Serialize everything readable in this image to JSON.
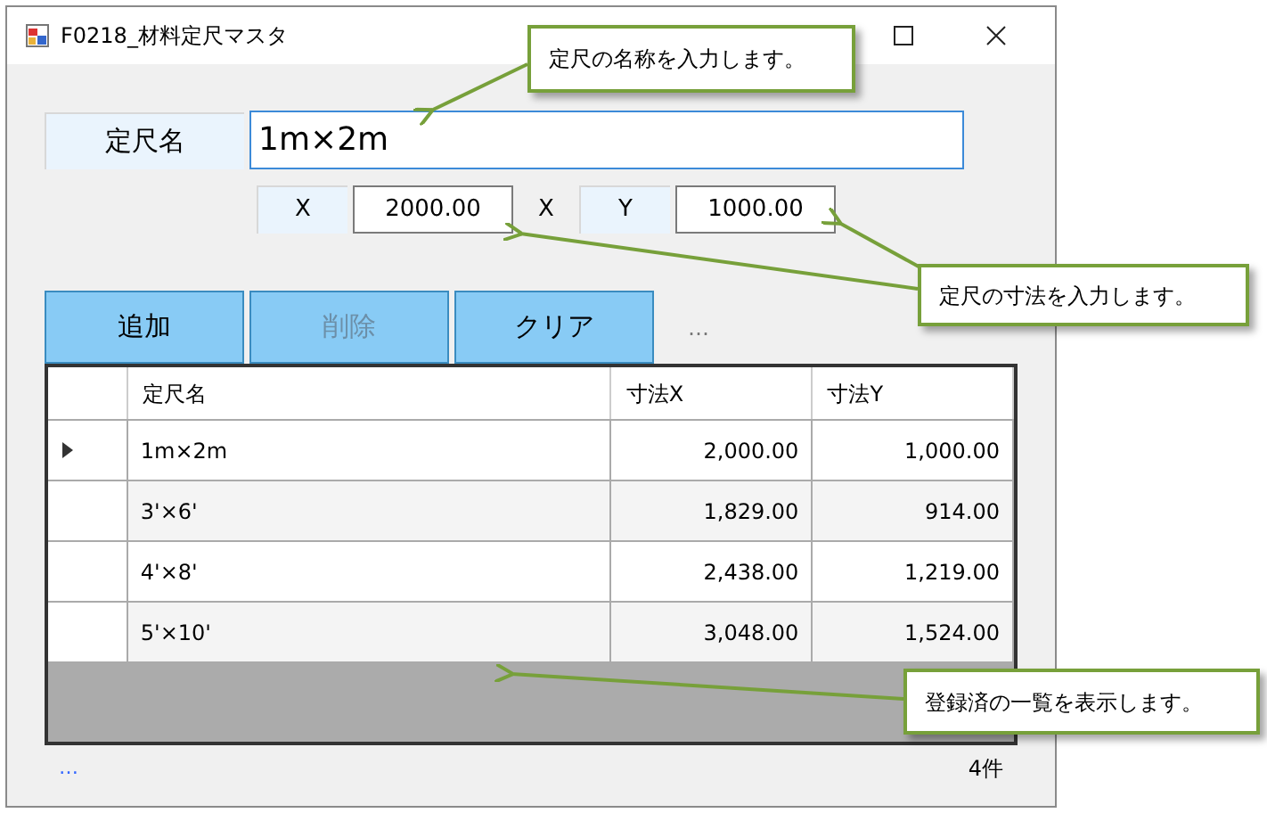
{
  "window": {
    "title": "F0218_材料定尺マスタ"
  },
  "name_field": {
    "label": "定尺名",
    "value": "1m×2m"
  },
  "size_fields": [
    {
      "label": "X",
      "value": "2000.00"
    },
    {
      "label": "Y",
      "value": "1000.00"
    }
  ],
  "size_separator": "X",
  "buttons": [
    {
      "label": "追加",
      "disabled": false
    },
    {
      "label": "削除",
      "disabled": true
    },
    {
      "label": "クリア",
      "disabled": false
    }
  ],
  "more": "…",
  "table": {
    "columns": [
      "定尺名",
      "寸法X",
      "寸法Y"
    ],
    "rows": [
      {
        "selected": true,
        "cells": [
          "1m×2m",
          "2,000.00",
          "1,000.00"
        ]
      },
      {
        "selected": false,
        "cells": [
          "3'×6'",
          "1,829.00",
          "914.00"
        ]
      },
      {
        "selected": false,
        "cells": [
          "4'×8'",
          "2,438.00",
          "1,219.00"
        ]
      },
      {
        "selected": false,
        "cells": [
          "5'×10'",
          "3,048.00",
          "1,524.00"
        ]
      }
    ]
  },
  "status_bar": {
    "link": "…",
    "count": "4件"
  },
  "callouts": [
    "定尺の名称を入力します。",
    "定尺の寸法を入力します。",
    "登録済の一覧を表示します。"
  ]
}
